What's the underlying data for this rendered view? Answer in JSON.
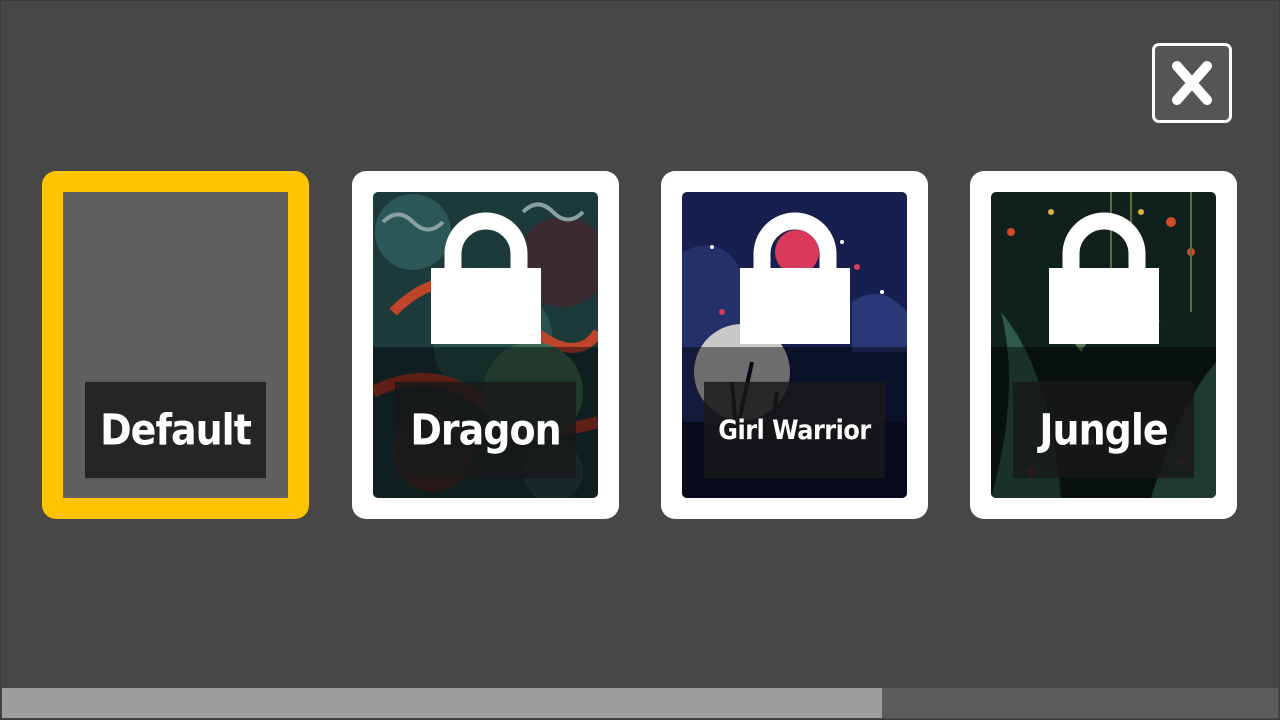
{
  "close_button": {
    "icon": "close-icon"
  },
  "skins": [
    {
      "name": "Default",
      "selected": true,
      "locked": false
    },
    {
      "name": "Dragon",
      "selected": false,
      "locked": true
    },
    {
      "name": "Girl Warrior",
      "selected": false,
      "locked": true
    },
    {
      "name": "Jungle",
      "selected": false,
      "locked": true
    }
  ],
  "colors": {
    "background": "#474747",
    "selected_border": "#ffc400",
    "locked_border": "#ffffff",
    "progress_fill": "#9d9d9d",
    "progress_track": "#5c5c5c"
  },
  "scroll_progress": 0.69
}
